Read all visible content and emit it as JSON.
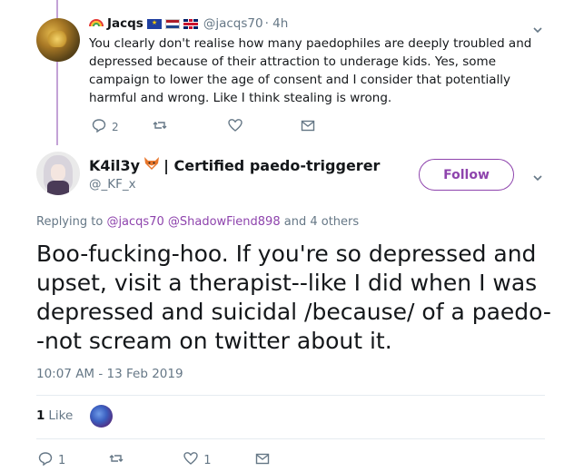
{
  "reply_tweet": {
    "name_prefix_emoji": "rainbow-icon",
    "name": "Jacqs",
    "flags": [
      "eu-flag",
      "nl-flag",
      "uk-flag"
    ],
    "handle": "@jacqs70",
    "time": "· 4h",
    "text": "You clearly don't realise how many paedophiles are deeply troubled and depressed because of their attraction to underage kids. Yes, some campaign to lower the age of consent and I consider that potentially harmful and wrong. Like I think stealing is wrong.",
    "actions": {
      "reply_count": "2",
      "retweet_count": "",
      "like_count": ""
    }
  },
  "main_tweet": {
    "name_part1": "K4il3y",
    "name_emoji": "🦊",
    "name_part2": "| Certified paedo-triggerer",
    "handle": "@_KF_x",
    "follow_label": "Follow",
    "replying_prefix": "Replying to",
    "replying_mentions": "@jacqs70 @ShadowFiend898",
    "replying_suffix": "and 4 others",
    "text": "Boo-fucking-hoo. If you're so depressed and upset, visit a therapist--like I did when I was depressed and suicidal /because/ of a paedo--not scream on twitter about it.",
    "timestamp": "10:07 AM - 13 Feb 2019",
    "likes_count": "1",
    "likes_label": "Like",
    "actions": {
      "reply_count": "1",
      "retweet_count": "",
      "like_count": "1"
    }
  },
  "colors": {
    "accent": "#8e44ad",
    "thread_line": "#c3a2d6",
    "muted": "#657786"
  }
}
